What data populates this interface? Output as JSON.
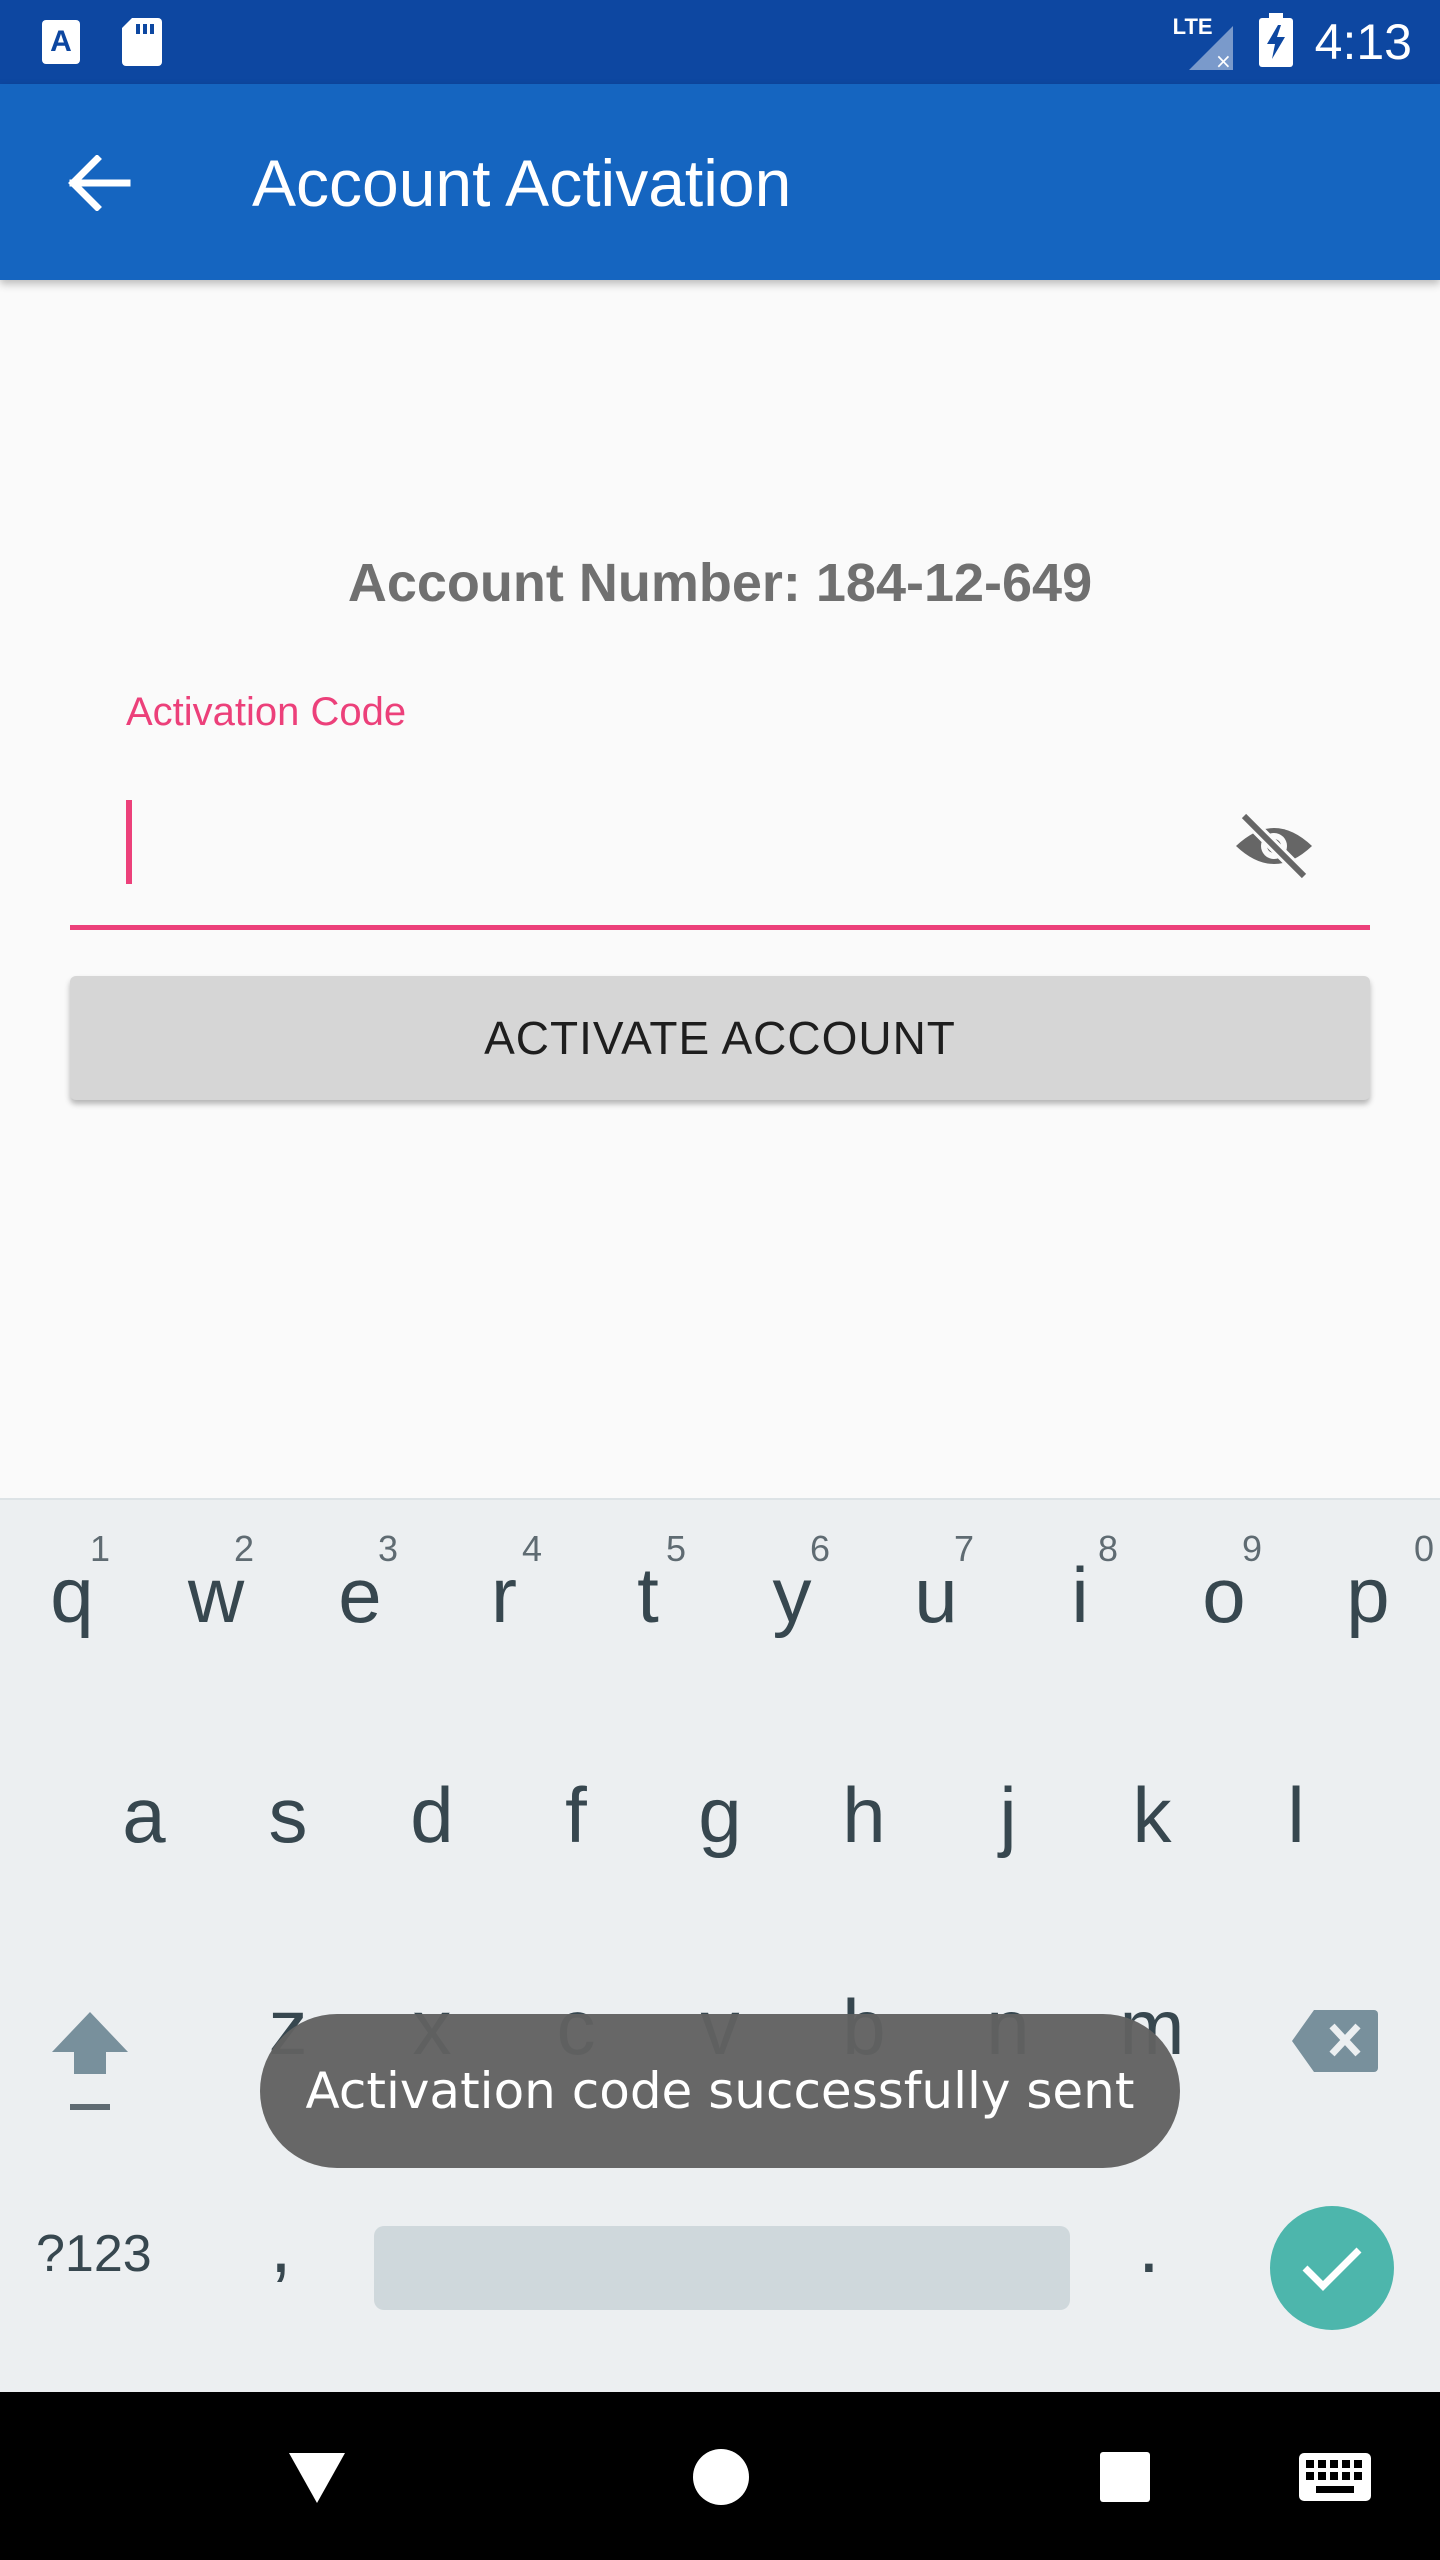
{
  "status_bar": {
    "time": "4:13",
    "network": "LTE",
    "icons": [
      "app-notification-icon",
      "sd-card-icon",
      "signal-icon",
      "battery-charging-icon"
    ]
  },
  "app_bar": {
    "title": "Account Activation",
    "back_icon": "arrow-back-icon"
  },
  "content": {
    "account_number": "Account Number: 184-12-649",
    "activation_code_label": "Activation Code",
    "activation_code_value": "",
    "visibility_icon": "eye-off-icon",
    "activate_button": "ACTIVATE ACCOUNT"
  },
  "colors": {
    "status_bar": "#0d47a1",
    "app_bar": "#1565c0",
    "accent": "#ec407a",
    "enter_key": "#4db6ac"
  },
  "keyboard": {
    "row1": [
      {
        "key": "q",
        "hint": "1"
      },
      {
        "key": "w",
        "hint": "2"
      },
      {
        "key": "e",
        "hint": "3"
      },
      {
        "key": "r",
        "hint": "4"
      },
      {
        "key": "t",
        "hint": "5"
      },
      {
        "key": "y",
        "hint": "6"
      },
      {
        "key": "u",
        "hint": "7"
      },
      {
        "key": "i",
        "hint": "8"
      },
      {
        "key": "o",
        "hint": "9"
      },
      {
        "key": "p",
        "hint": "0"
      }
    ],
    "row2": [
      "a",
      "s",
      "d",
      "f",
      "g",
      "h",
      "j",
      "k",
      "l"
    ],
    "row3": [
      "z",
      "x",
      "c",
      "v",
      "b",
      "n",
      "m"
    ],
    "symbols_label": "?123",
    "comma": ",",
    "period": "."
  },
  "toast": {
    "message": "Activation code successfully sent"
  },
  "nav_bar": {
    "buttons": [
      "back-triangle-icon",
      "home-circle-icon",
      "recents-square-icon",
      "keyboard-switch-icon"
    ]
  }
}
